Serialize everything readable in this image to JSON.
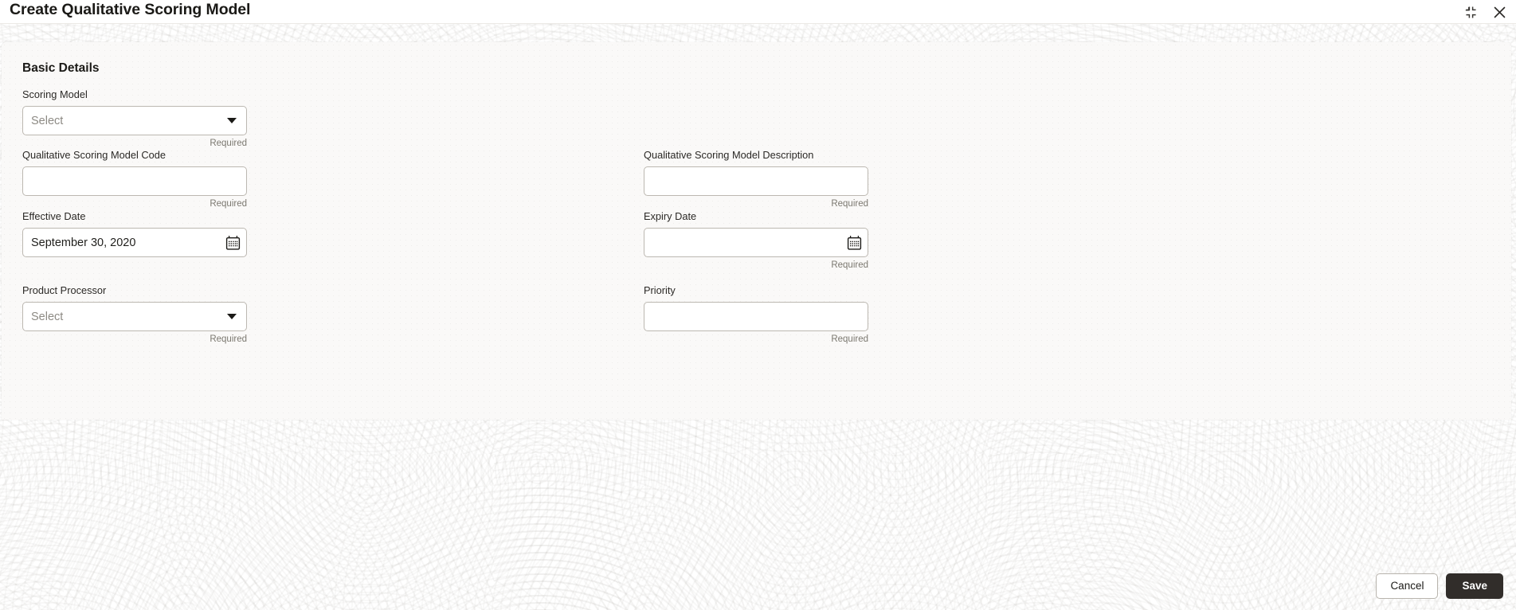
{
  "window": {
    "title": "Create Qualitative Scoring Model",
    "controls": [
      {
        "name": "collapse-icon",
        "label": "Collapse"
      },
      {
        "name": "close-icon",
        "label": "Close"
      }
    ]
  },
  "section": {
    "title": "Basic Details"
  },
  "fields": [
    {
      "id": "scoring-model",
      "label": "Scoring Model",
      "type": "select",
      "value": "",
      "placeholder": "Select",
      "hint": "Required",
      "column": "left",
      "row": 1
    },
    {
      "id": "qualitative-scoring-model-code",
      "label": "Qualitative Scoring Model Code",
      "type": "text",
      "value": "",
      "placeholder": "",
      "hint": "Required",
      "column": "left",
      "row": 2
    },
    {
      "id": "qualitative-scoring-model-description",
      "label": "Qualitative Scoring Model Description",
      "type": "text",
      "value": "",
      "placeholder": "",
      "hint": "Required",
      "column": "right",
      "row": 2
    },
    {
      "id": "effective-date",
      "label": "Effective Date",
      "type": "date",
      "value": "September 30, 2020",
      "placeholder": "",
      "hint": "",
      "column": "left",
      "row": 3
    },
    {
      "id": "expiry-date",
      "label": "Expiry Date",
      "type": "date",
      "value": "",
      "placeholder": "",
      "hint": "Required",
      "column": "right",
      "row": 3
    },
    {
      "id": "product-processor",
      "label": "Product Processor",
      "type": "select",
      "value": "",
      "placeholder": "Select",
      "hint": "Required",
      "column": "left",
      "row": 4
    },
    {
      "id": "priority",
      "label": "Priority",
      "type": "text",
      "value": "",
      "placeholder": "",
      "hint": "Required",
      "column": "right",
      "row": 4
    }
  ],
  "footer": {
    "cancel_label": "Cancel",
    "save_label": "Save"
  },
  "colors": {
    "page_background": "#ffffff",
    "panel_background": "#faf9f8",
    "text_primary": "#1b1a17",
    "text_hint": "#7b7870",
    "field_border": "#bcb8b1",
    "primary_button": "#312d2a"
  }
}
